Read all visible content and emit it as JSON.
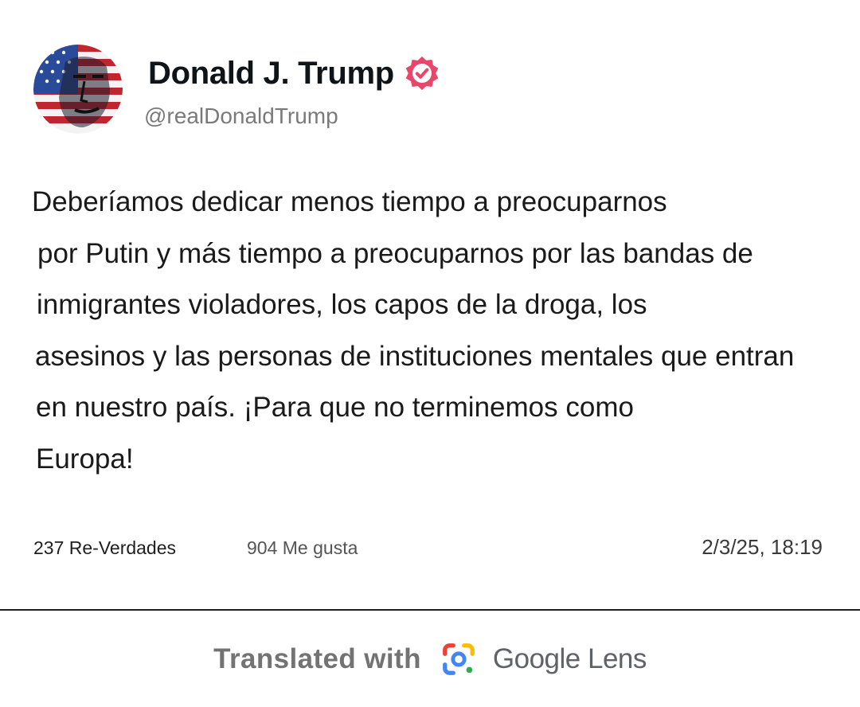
{
  "author": {
    "display_name": "Donald J. Trump",
    "handle": "@realDonaldTrump",
    "verified_icon": "verified-badge-icon",
    "avatar_icon": "profile-avatar-flag"
  },
  "post": {
    "lines": [
      "Deberíamos dedicar menos tiempo a preocuparnos",
      "por Putin y más tiempo a preocuparnos por las bandas de",
      "inmigrantes violadores, los capos de la droga, los",
      "asesinos y las personas de instituciones mentales que entran",
      "en nuestro país. ¡Para que no terminemos como",
      "Europa!"
    ]
  },
  "stats": {
    "reposts": "237 Re-Verdades",
    "likes": "904 Me gusta",
    "timestamp": "2/3/25, 18:19"
  },
  "footer": {
    "translated_label": "Translated with",
    "brand": "Google Lens",
    "lens_icon": "google-lens-icon"
  },
  "colors": {
    "verified_badge": "#e8476b",
    "lens_blue": "#4285f4",
    "lens_red": "#ea4335",
    "lens_yellow": "#fbbc05",
    "lens_green": "#34a853"
  }
}
